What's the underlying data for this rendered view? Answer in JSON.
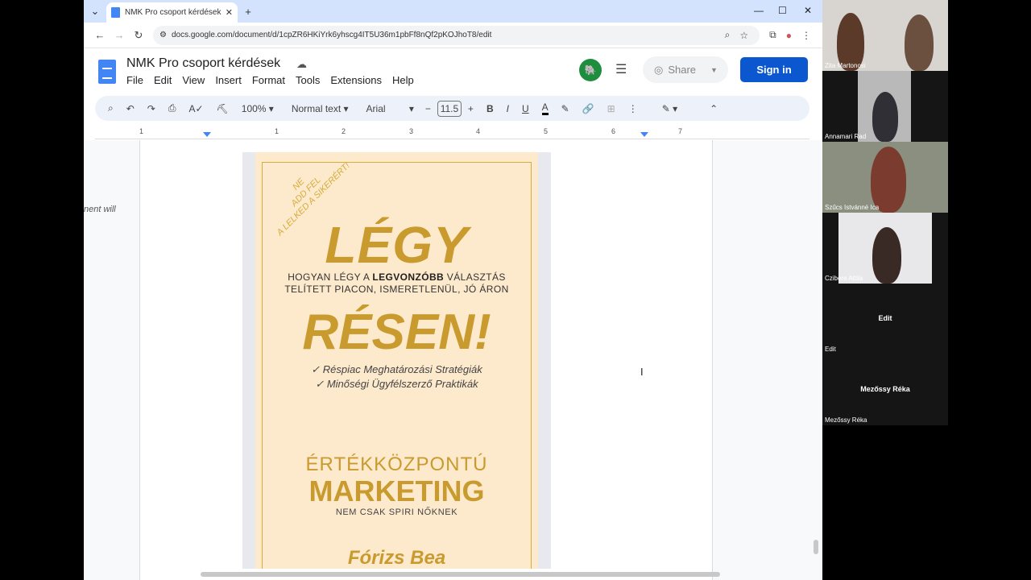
{
  "tab": {
    "title": "NMK Pro csoport kérdések - G"
  },
  "address": {
    "url": "docs.google.com/document/d/1cpZR6HKiYrk6yhscg4IT5U36m1pbFf8nQf2pKOJhoT8/edit"
  },
  "doc": {
    "title": "NMK Pro csoport kérdések",
    "menus": [
      "File",
      "Edit",
      "View",
      "Insert",
      "Format",
      "Tools",
      "Extensions",
      "Help"
    ],
    "share_label": "Share",
    "signin_label": "Sign in"
  },
  "toolbar": {
    "zoom": "100%",
    "style": "Normal text",
    "font": "Arial",
    "font_size": "11.5"
  },
  "ruler": {
    "numbers": [
      "1",
      "1",
      "2",
      "3",
      "4",
      "5",
      "6",
      "7"
    ]
  },
  "page": {
    "side_text": "nent will"
  },
  "cover": {
    "stamp": [
      "NE",
      "ADD FEL",
      "A LELKED A SIKERÉRT!"
    ],
    "title1": "LÉGY",
    "subtitle_pre": "HOGYAN LÉGY A ",
    "subtitle_bold": "LEGVONZÓBB",
    "subtitle_post": " VÁLASZTÁS",
    "subtitle_line2": "TELÍTETT PIACON, ISMERETLENÜL, JÓ ÁRON",
    "title2": "RÉSEN!",
    "check1": "✓ Réspiac Meghatározási Stratégiák",
    "check2": "✓ Minőségi Ügyfélszerző Praktikák",
    "ert": "ÉRTÉKKÖZPONTÚ",
    "marketing": "MARKETING",
    "tagline": "NEM CSAK SPIRI NŐKNEK",
    "author": "Fórizs Bea"
  },
  "participants": [
    {
      "name": "Zita Martonosi"
    },
    {
      "name": "Annamari Rad"
    },
    {
      "name": "Szűcs Istvánné Ica"
    },
    {
      "name": "Czibere Attila"
    },
    {
      "name": "Edit",
      "center": "Edit"
    },
    {
      "name": "Mezőssy Réka",
      "center": "Mezőssy Réka"
    }
  ],
  "colors": {
    "accent": "#0b57d0",
    "gold": "#c99b2e",
    "cover_bg": "#fde9cc",
    "tab_strip": "#d3e3fd"
  }
}
